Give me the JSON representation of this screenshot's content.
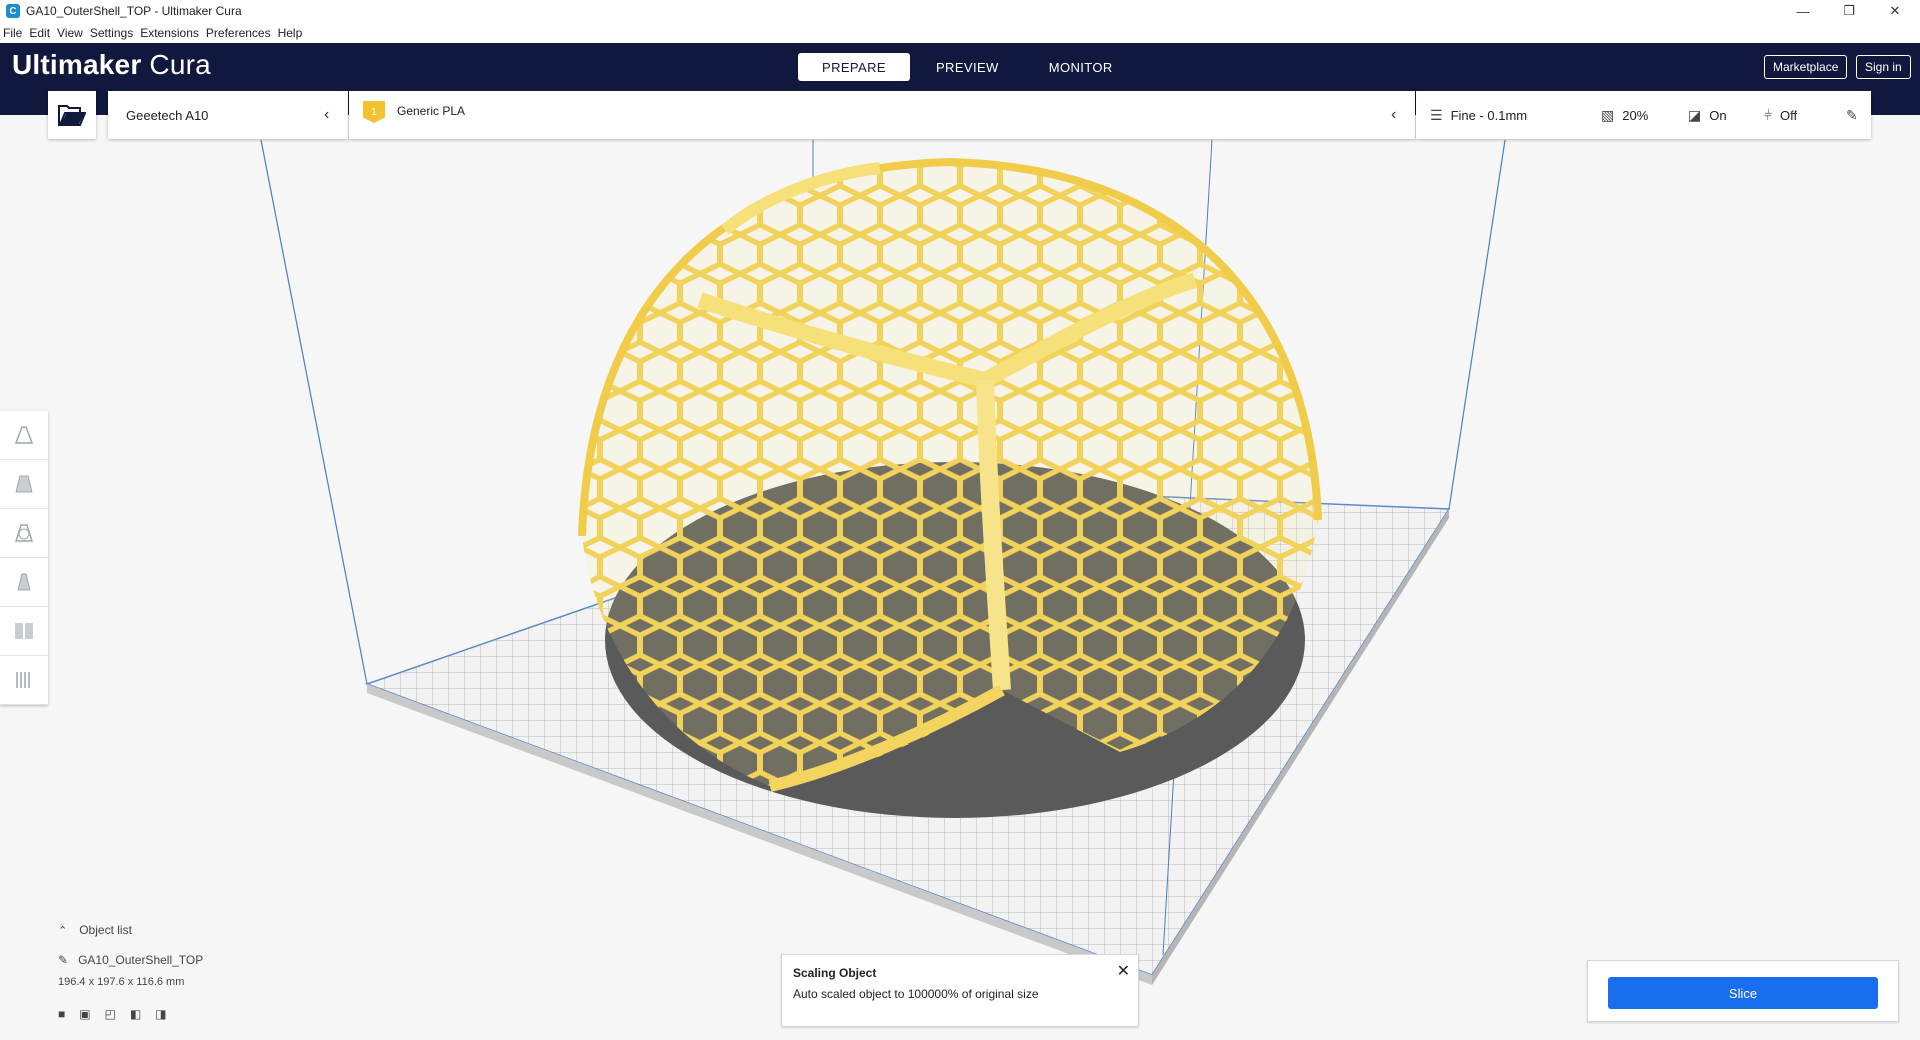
{
  "window": {
    "title": "GA10_OuterShell_TOP - Ultimaker Cura",
    "minimize_glyph": "—",
    "restore_glyph": "❐",
    "close_glyph": "✕",
    "app_icon_glyph": "C"
  },
  "menu": [
    "File",
    "Edit",
    "View",
    "Settings",
    "Extensions",
    "Preferences",
    "Help"
  ],
  "header": {
    "logo_bold": "Ultimaker",
    "logo_light": "Cura",
    "tabs": [
      "PREPARE",
      "PREVIEW",
      "MONITOR"
    ],
    "active_tab": "PREPARE",
    "marketplace_label": "Marketplace",
    "signin_label": "Sign in"
  },
  "printer": {
    "name": "Geeetech A10"
  },
  "material": {
    "extruder_number": "1",
    "name": "Generic PLA"
  },
  "print_settings": {
    "profile": "Fine - 0.1mm",
    "infill": "20%",
    "support": "On",
    "adhesion": "Off"
  },
  "tools": [
    "move-tool",
    "scale-tool",
    "rotate-tool",
    "mirror-tool",
    "per-model-settings-tool",
    "support-blocker-tool"
  ],
  "object_list": {
    "header": "Object list",
    "object_name": "GA10_OuterShell_TOP",
    "dimensions": "196.4 x 197.6 x 116.6 mm"
  },
  "message": {
    "title": "Scaling Object",
    "body": "Auto scaled object to 100000% of original size"
  },
  "slice": {
    "label": "Slice"
  },
  "colors": {
    "header_bg": "#10183e",
    "accent_blue": "#196ef0",
    "model_yellow": "#f6e07a",
    "extruder_badge": "#f2c230"
  }
}
